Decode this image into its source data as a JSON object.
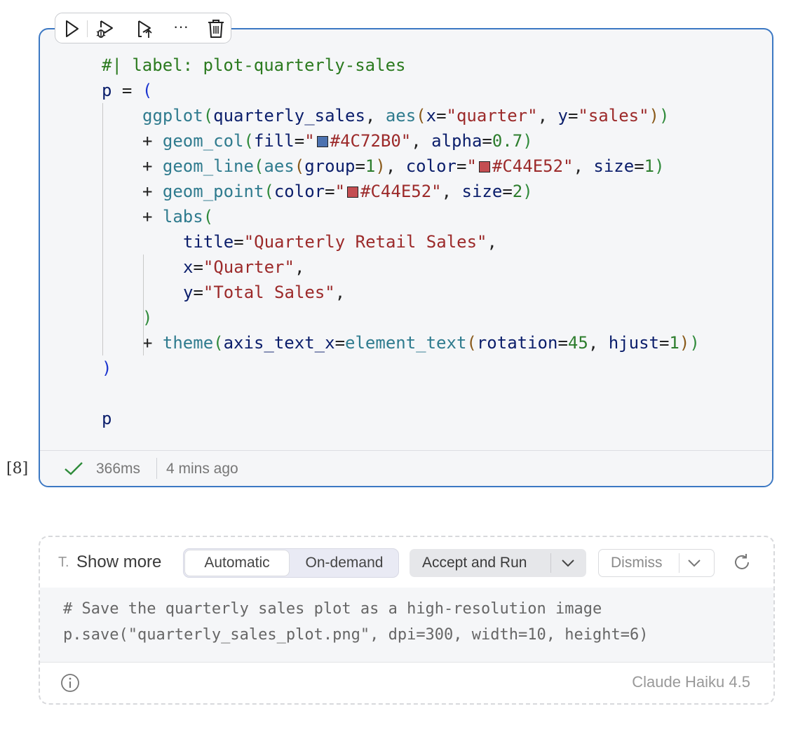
{
  "cell": {
    "execution_count": "[8]",
    "lines": [
      [
        {
          "t": "#| label: plot-quarterly-sales",
          "c": "cm"
        }
      ],
      [
        {
          "t": "p",
          "c": "id"
        },
        {
          "t": " = ",
          "c": "op"
        },
        {
          "t": "(",
          "c": "p1"
        }
      ],
      [
        {
          "t": "ggplot",
          "c": "fn"
        },
        {
          "t": "(",
          "c": "p2"
        },
        {
          "t": "quarterly_sales",
          "c": "id"
        },
        {
          "t": ", ",
          "c": "op"
        },
        {
          "t": "aes",
          "c": "fn"
        },
        {
          "t": "(",
          "c": "p3"
        },
        {
          "t": "x",
          "c": "id"
        },
        {
          "t": "=",
          "c": "op"
        },
        {
          "t": "\"quarter\"",
          "c": "str"
        },
        {
          "t": ", ",
          "c": "op"
        },
        {
          "t": "y",
          "c": "id"
        },
        {
          "t": "=",
          "c": "op"
        },
        {
          "t": "\"sales\"",
          "c": "str"
        },
        {
          "t": ")",
          "c": "p3"
        },
        {
          "t": ")",
          "c": "p2"
        }
      ],
      [
        {
          "t": "+ ",
          "c": "op"
        },
        {
          "t": "geom_col",
          "c": "fn"
        },
        {
          "t": "(",
          "c": "p2"
        },
        {
          "t": "fill",
          "c": "id"
        },
        {
          "t": "=",
          "c": "op"
        },
        {
          "t": "\"",
          "c": "str"
        },
        {
          "sw": "#4C72B0"
        },
        {
          "t": "#4C72B0\"",
          "c": "str"
        },
        {
          "t": ", ",
          "c": "op"
        },
        {
          "t": "alpha",
          "c": "id"
        },
        {
          "t": "=",
          "c": "op"
        },
        {
          "t": "0.7",
          "c": "num"
        },
        {
          "t": ")",
          "c": "p2"
        }
      ],
      [
        {
          "t": "+ ",
          "c": "op"
        },
        {
          "t": "geom_line",
          "c": "fn"
        },
        {
          "t": "(",
          "c": "p2"
        },
        {
          "t": "aes",
          "c": "fn"
        },
        {
          "t": "(",
          "c": "p3"
        },
        {
          "t": "group",
          "c": "id"
        },
        {
          "t": "=",
          "c": "op"
        },
        {
          "t": "1",
          "c": "num"
        },
        {
          "t": ")",
          "c": "p3"
        },
        {
          "t": ", ",
          "c": "op"
        },
        {
          "t": "color",
          "c": "id"
        },
        {
          "t": "=",
          "c": "op"
        },
        {
          "t": "\"",
          "c": "str"
        },
        {
          "sw": "#C44E52"
        },
        {
          "t": "#C44E52\"",
          "c": "str"
        },
        {
          "t": ", ",
          "c": "op"
        },
        {
          "t": "size",
          "c": "id"
        },
        {
          "t": "=",
          "c": "op"
        },
        {
          "t": "1",
          "c": "num"
        },
        {
          "t": ")",
          "c": "p2"
        }
      ],
      [
        {
          "t": "+ ",
          "c": "op"
        },
        {
          "t": "geom_point",
          "c": "fn"
        },
        {
          "t": "(",
          "c": "p2"
        },
        {
          "t": "color",
          "c": "id"
        },
        {
          "t": "=",
          "c": "op"
        },
        {
          "t": "\"",
          "c": "str"
        },
        {
          "sw": "#C44E52"
        },
        {
          "t": "#C44E52\"",
          "c": "str"
        },
        {
          "t": ", ",
          "c": "op"
        },
        {
          "t": "size",
          "c": "id"
        },
        {
          "t": "=",
          "c": "op"
        },
        {
          "t": "2",
          "c": "num"
        },
        {
          "t": ")",
          "c": "p2"
        }
      ],
      [
        {
          "t": "+ ",
          "c": "op"
        },
        {
          "t": "labs",
          "c": "fn"
        },
        {
          "t": "(",
          "c": "p2"
        }
      ],
      [
        {
          "t": "title",
          "c": "id"
        },
        {
          "t": "=",
          "c": "op"
        },
        {
          "t": "\"Quarterly Retail Sales\"",
          "c": "str"
        },
        {
          "t": ",",
          "c": "op"
        }
      ],
      [
        {
          "t": "x",
          "c": "id"
        },
        {
          "t": "=",
          "c": "op"
        },
        {
          "t": "\"Quarter\"",
          "c": "str"
        },
        {
          "t": ",",
          "c": "op"
        }
      ],
      [
        {
          "t": "y",
          "c": "id"
        },
        {
          "t": "=",
          "c": "op"
        },
        {
          "t": "\"Total Sales\"",
          "c": "str"
        },
        {
          "t": ",",
          "c": "op"
        }
      ],
      [
        {
          "t": ")",
          "c": "p2"
        }
      ],
      [
        {
          "t": "+ ",
          "c": "op"
        },
        {
          "t": "theme",
          "c": "fn"
        },
        {
          "t": "(",
          "c": "p2"
        },
        {
          "t": "axis_text_x",
          "c": "id"
        },
        {
          "t": "=",
          "c": "op"
        },
        {
          "t": "element_text",
          "c": "fn"
        },
        {
          "t": "(",
          "c": "p3"
        },
        {
          "t": "rotation",
          "c": "id"
        },
        {
          "t": "=",
          "c": "op"
        },
        {
          "t": "45",
          "c": "num"
        },
        {
          "t": ", ",
          "c": "op"
        },
        {
          "t": "hjust",
          "c": "id"
        },
        {
          "t": "=",
          "c": "op"
        },
        {
          "t": "1",
          "c": "num"
        },
        {
          "t": ")",
          "c": "p3"
        },
        {
          "t": ")",
          "c": "p2"
        }
      ],
      [
        {
          "t": ")",
          "c": "p1"
        }
      ],
      [],
      [
        {
          "t": "p",
          "c": "id"
        }
      ]
    ],
    "status": {
      "duration": "366ms",
      "time_ago": "4 mins ago",
      "state": "success"
    }
  },
  "toolbar": {
    "buttons": [
      "run-icon",
      "debug-icon",
      "run-above-icon",
      "more-icon",
      "delete-icon"
    ],
    "more_label": "···"
  },
  "suggestion": {
    "type_abbrev": "T.",
    "show_more": "Show more",
    "modes": [
      "Automatic",
      "On-demand"
    ],
    "selected_mode": "Automatic",
    "accept_label": "Accept and Run",
    "dismiss_label": "Dismiss",
    "code": [
      "# Save the quarterly sales plot as a high-resolution image",
      "p.save(\"quarterly_sales_plot.png\", dpi=300, width=10, height=6)"
    ],
    "model": "Claude Haiku 4.5"
  },
  "colors": {
    "cell_border": "#3c78c3",
    "success": "#2e8b3a",
    "swatch_blue": "#4C72B0",
    "swatch_red": "#C44E52"
  }
}
